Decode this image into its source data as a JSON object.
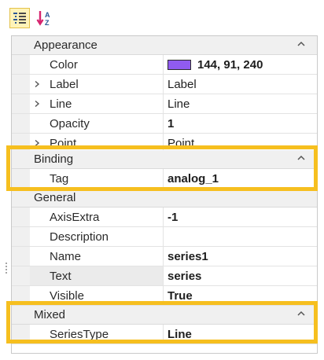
{
  "toolbar": {
    "categorized_icon": "categorized-view-icon",
    "alphabetical_icon": "alphabetical-sort-icon"
  },
  "categories": {
    "appearance": "Appearance",
    "binding": "Binding",
    "general": "General",
    "mixed": "Mixed"
  },
  "appearance": {
    "color": {
      "name": "Color",
      "value": "144, 91, 240",
      "swatch": "#905BF0"
    },
    "label": {
      "name": "Label",
      "value": "Label"
    },
    "line": {
      "name": "Line",
      "value": "Line"
    },
    "opacity": {
      "name": "Opacity",
      "value": "1"
    },
    "point": {
      "name": "Point",
      "value": "Point"
    }
  },
  "binding": {
    "tag": {
      "name": "Tag",
      "value": "analog_1"
    }
  },
  "general": {
    "axisextra": {
      "name": "AxisExtra",
      "value": "-1"
    },
    "description": {
      "name": "Description",
      "value": ""
    },
    "name": {
      "name": "Name",
      "value": "series1"
    },
    "text": {
      "name": "Text",
      "value": "series"
    },
    "visible": {
      "name": "Visible",
      "value": "True"
    }
  },
  "mixed": {
    "seriestype": {
      "name": "SeriesType",
      "value": "Line"
    }
  },
  "colors": {
    "highlight": "#F6BF1F",
    "category_bg": "#F0F0F0",
    "grid_border": "#C9C9C9"
  }
}
